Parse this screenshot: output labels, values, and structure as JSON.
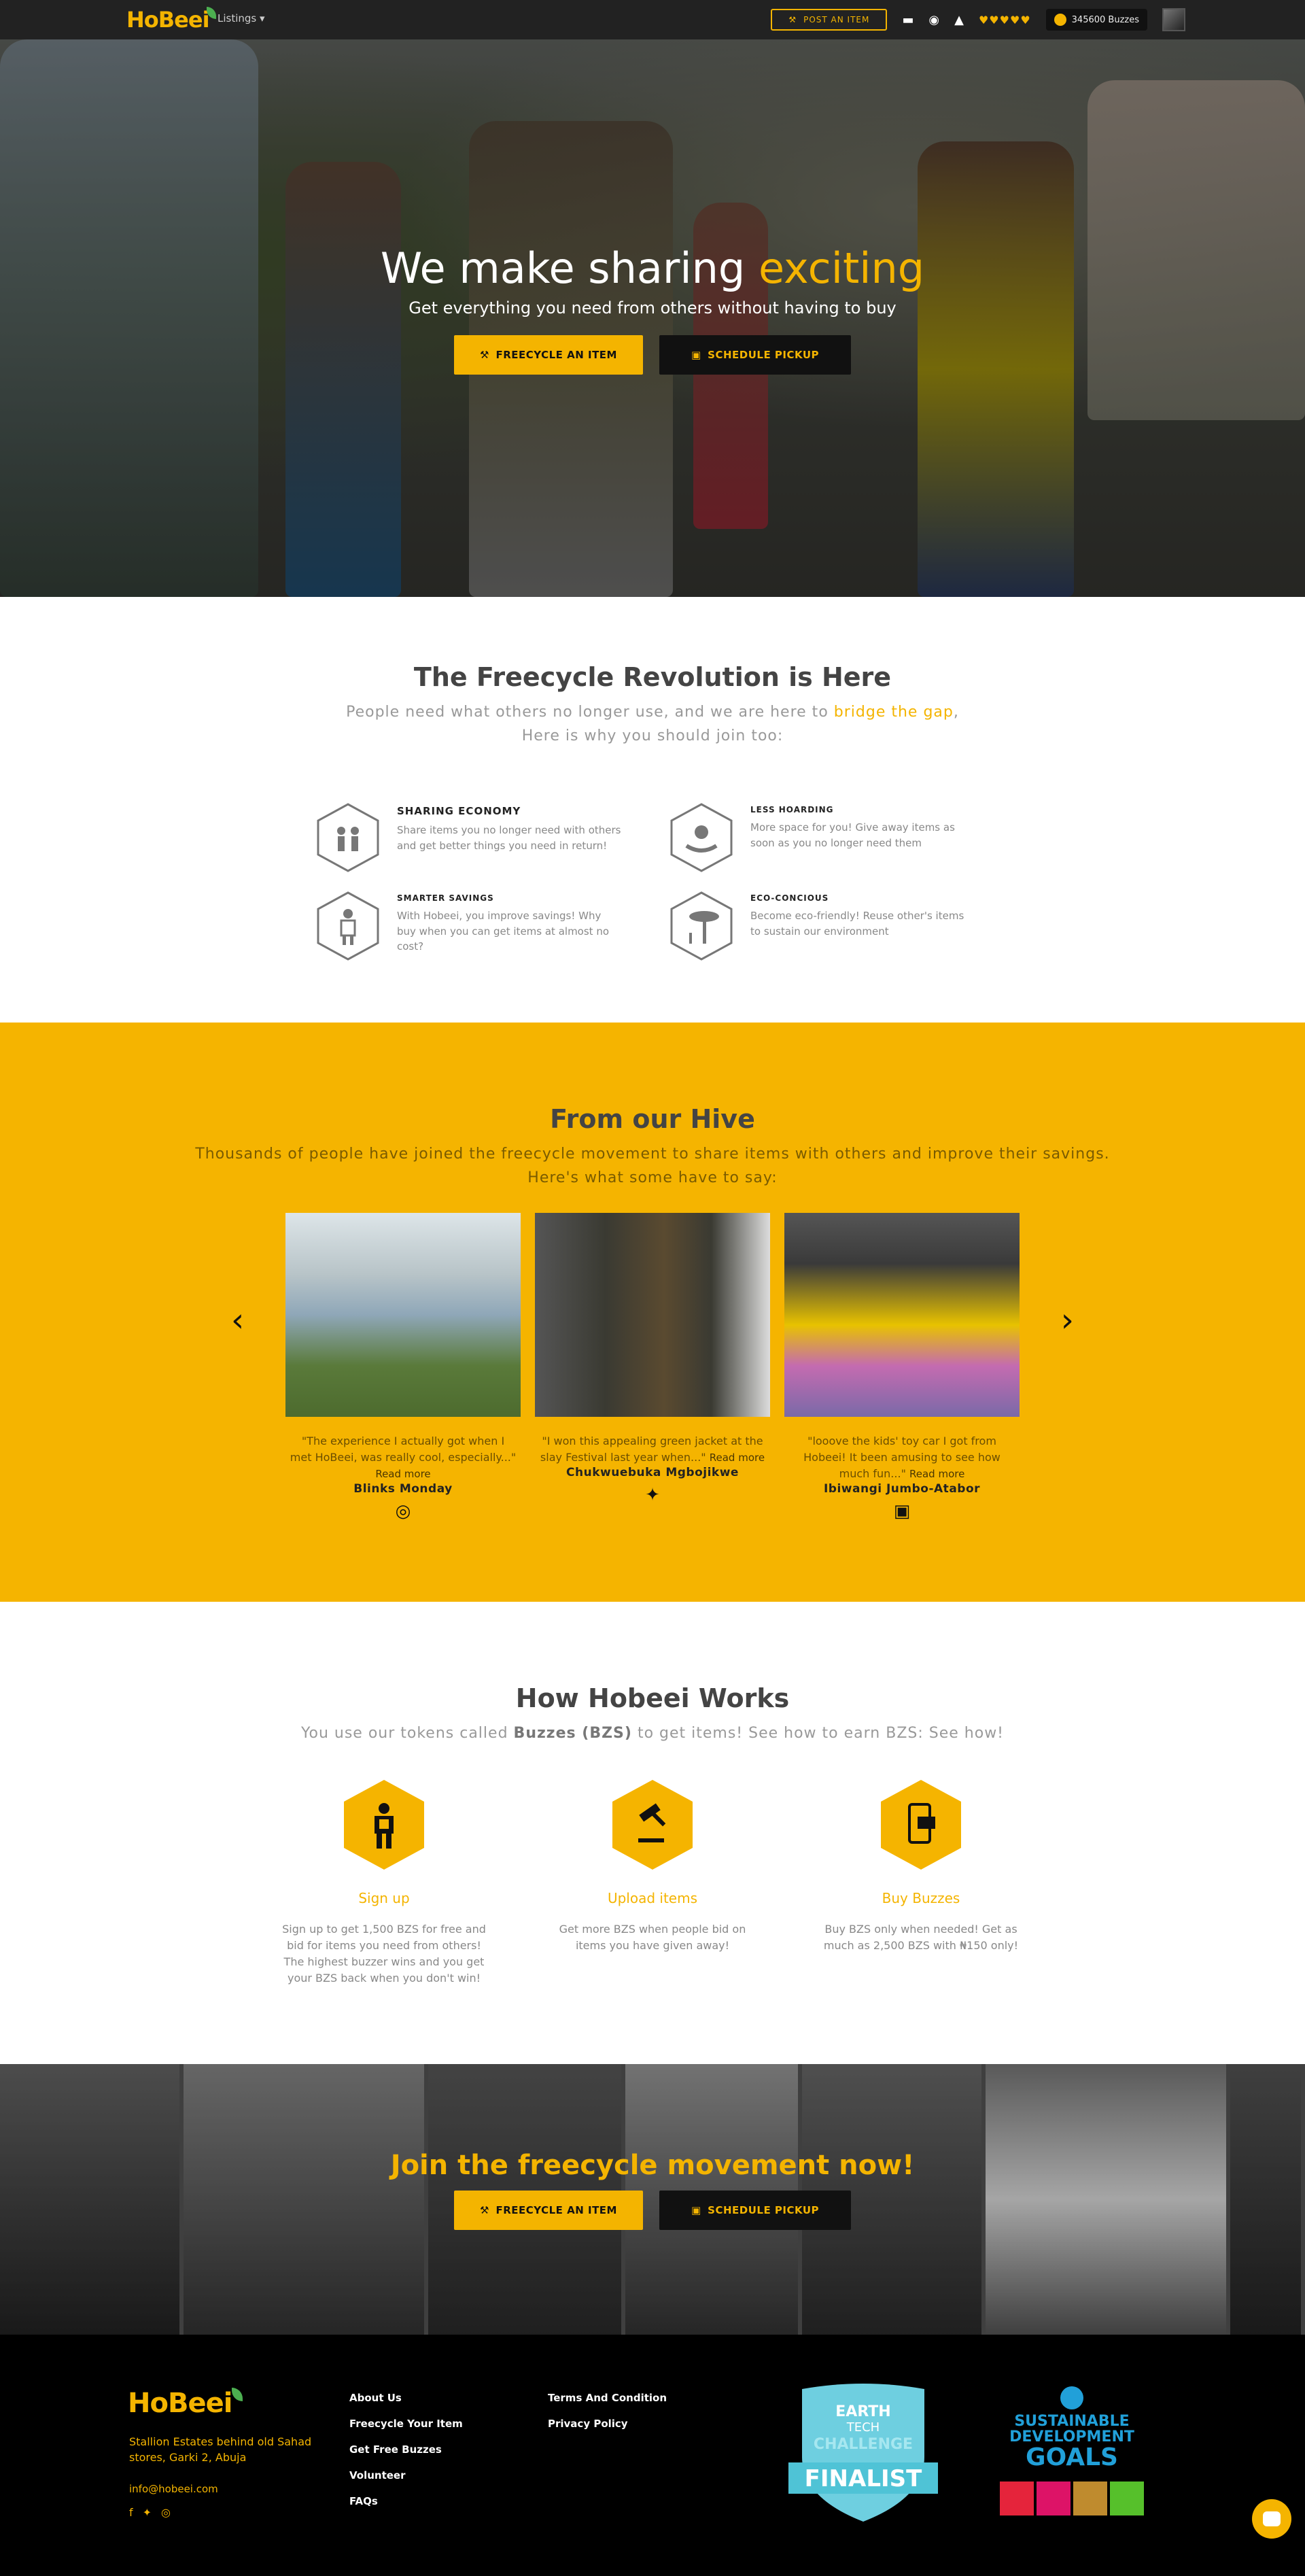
{
  "navbar": {
    "logo": "HoBeei",
    "listings": "Listings",
    "post_item": "POST AN ITEM",
    "hearts": "♥♥♥♥♥",
    "buzzes": "345600 Buzzes"
  },
  "hero": {
    "title_main": "We make sharing",
    "title_accent": "exciting",
    "subtitle": "Get everything you need from others without having to buy",
    "btn_freecycle": "FREECYCLE AN ITEM",
    "btn_schedule": "SCHEDULE PICKUP"
  },
  "revolution": {
    "title": "The Freecycle Revolution is Here",
    "sub_part1": "People need what others no longer use, and we are here to",
    "sub_accent": "bridge the gap",
    "sub_part2": "Here is why you should join too:",
    "features": [
      {
        "title": "SHARING ECONOMY",
        "text": "Share items you no longer need with others and get better things you need in return!",
        "icon": "sharing-icon"
      },
      {
        "title": "LESS HOARDING",
        "text": "More space for you! Give away items as soon as you no longer need them",
        "icon": "hands-icon"
      },
      {
        "title": "SMARTER SAVINGS",
        "text": "With Hobeei, you improve savings! Why buy when you can get items at almost no cost?",
        "icon": "person-icon"
      },
      {
        "title": "ECO-CONCIOUS",
        "text": "Become eco-friendly! Reuse other's items to sustain our environment",
        "icon": "tree-icon"
      }
    ]
  },
  "hive": {
    "title": "From our Hive",
    "sub_line1": "Thousands of people have joined the freecycle movement to share items with others and improve their savings.",
    "sub_line2": "Here's what some have to say:",
    "read_more": "Read more",
    "testimonials": [
      {
        "quote": "\"The experience I actually got when I met HoBeei, was really cool, especially...\"",
        "name": "Blinks Monday",
        "social": "instagram-icon"
      },
      {
        "quote": "\"I won this appealing green jacket at the slay Festival last year when...\"",
        "name": "Chukwuebuka Mgbojikwe",
        "social": "twitter-icon"
      },
      {
        "quote": "\"looove the kids' toy car I got from Hobeei! It been amusing to see how much fun...\"",
        "name": "Ibiwangi Jumbo-Atabor",
        "social": "facebook-icon"
      }
    ]
  },
  "how": {
    "title": "How Hobeei Works",
    "sub_part1": "You use our tokens called",
    "sub_bold": "Buzzes (BZS)",
    "sub_part2": "to get items! See how to earn BZS: See how!",
    "steps": [
      {
        "title": "Sign up",
        "text": "Sign up to get 1,500 BZS for free and bid for items you need from others! The highest buzzer wins and you get your BZS back when you don't win!"
      },
      {
        "title": "Upload items",
        "text": "Get more BZS when people bid on items you have given away!"
      },
      {
        "title": "Buy Buzzes",
        "text": "Buy BZS only when needed! Get as much as 2,500 BZS with ₦150 only!"
      }
    ]
  },
  "join": {
    "title": "Join the freecycle movement now!",
    "btn_freecycle": "FREECYCLE AN ITEM",
    "btn_schedule": "SCHEDULE PICKUP"
  },
  "footer": {
    "logo": "HoBeei",
    "address": "Stallion Estates behind old Sahad stores, Garki 2, Abuja",
    "email": "info@hobeei.com",
    "col1": [
      "About Us",
      "Freecycle Your Item",
      "Get Free Buzzes",
      "Volunteer",
      "FAQs"
    ],
    "col2": [
      "Terms And Condition",
      "Privacy Policy"
    ],
    "badge_earth_line1": "EARTH",
    "badge_earth_line2": "TECH",
    "badge_earth_line3": "CHALLENGE",
    "badge_finalist": "FINALIST",
    "sdg_line1": "SUSTAINABLE",
    "sdg_line2": "DEVELOPMENT",
    "sdg_line3": "GOALS"
  }
}
